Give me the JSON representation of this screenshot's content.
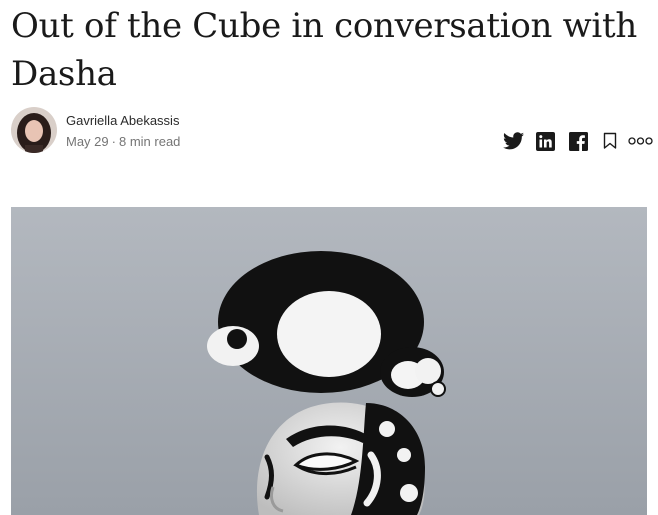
{
  "article": {
    "title": "Out of the Cube in conversation with Dasha"
  },
  "author": {
    "name": "Gavriella Abekassis",
    "date": "May 29",
    "separator": "·",
    "read_time": "8 min read"
  },
  "share_icons": [
    "twitter-icon",
    "linkedin-icon",
    "facebook-icon",
    "bookmark-icon",
    "more-icon"
  ],
  "colors": {
    "text": "#1a1a1a",
    "meta": "#757575",
    "hero_bg": "#b2b7bd"
  }
}
